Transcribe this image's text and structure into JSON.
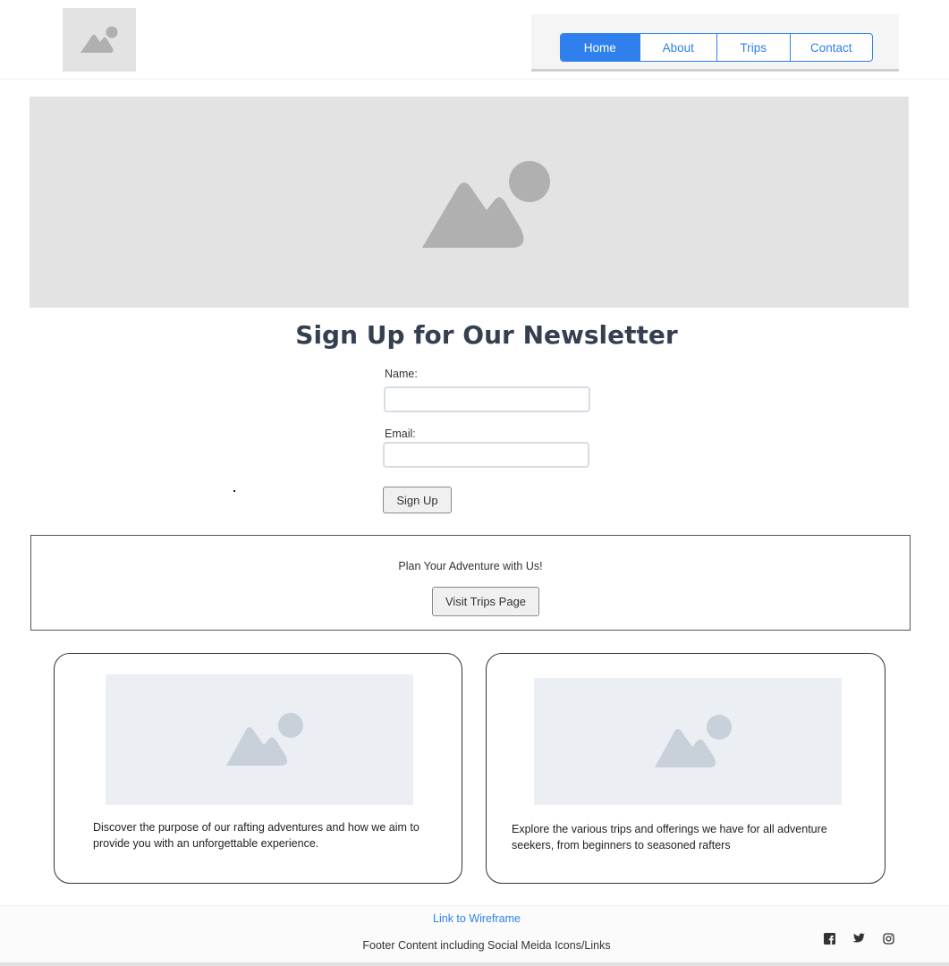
{
  "header": {
    "nav": [
      {
        "label": "Home",
        "active": true
      },
      {
        "label": "About",
        "active": false
      },
      {
        "label": "Trips",
        "active": false
      },
      {
        "label": "Contact",
        "active": false
      }
    ]
  },
  "newsletter": {
    "title": "Sign Up for Our Newsletter",
    "name_label": "Name:",
    "name_value": "",
    "email_label": "Email:",
    "email_value": "",
    "submit_label": "Sign Up"
  },
  "cta": {
    "text": "Plan Your Adventure with Us!",
    "button_label": "Visit Trips Page"
  },
  "cards": [
    {
      "text": "Discover the purpose of our rafting adventures and how we aim to provide you with an unforgettable experience."
    },
    {
      "text": "Explore the various trips and offerings we have for all adventure seekers, from beginners to seasoned rafters"
    }
  ],
  "footer": {
    "link_label": "Link to Wireframe",
    "text": "Footer Content including Social Meida Icons/Links",
    "social": [
      "facebook-icon",
      "twitter-icon",
      "instagram-icon"
    ]
  },
  "colors": {
    "accent": "#2f80ed",
    "placeholder_gray": "#e3e3e3",
    "placeholder_icon": "#b0b0b0",
    "card_placeholder": "#ebeff3",
    "card_placeholder_icon": "#c8d0d9",
    "heading": "#34404f"
  }
}
